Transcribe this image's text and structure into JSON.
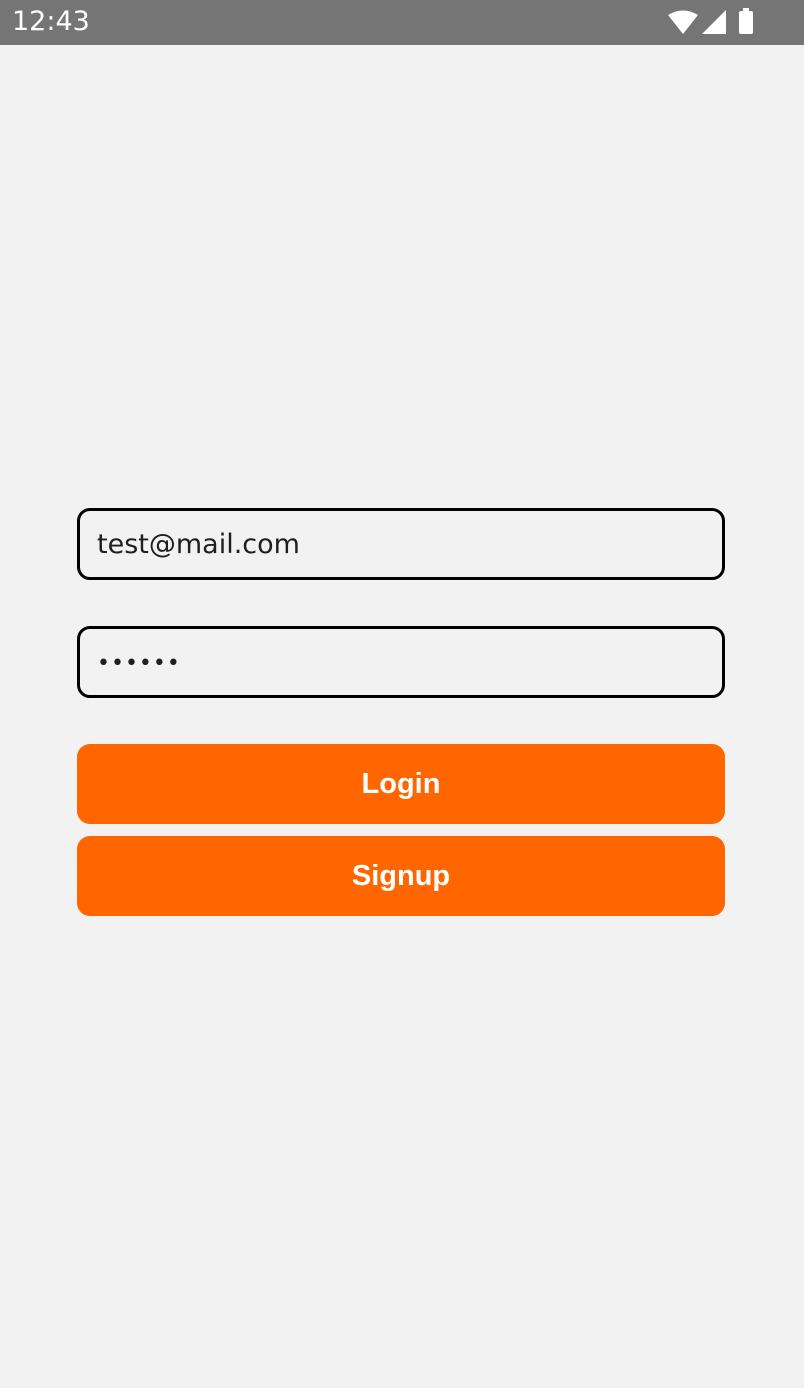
{
  "status_bar": {
    "time": "12:43",
    "icons": [
      "wifi-icon",
      "signal-icon",
      "battery-icon"
    ],
    "background": "#757575"
  },
  "form": {
    "email": {
      "value": "test@mail.com"
    },
    "password": {
      "value": "pass12"
    },
    "login_label": "Login",
    "signup_label": "Signup"
  },
  "colors": {
    "accent": "#ff6600",
    "background": "#f2f2f2",
    "input_border": "#000000"
  }
}
